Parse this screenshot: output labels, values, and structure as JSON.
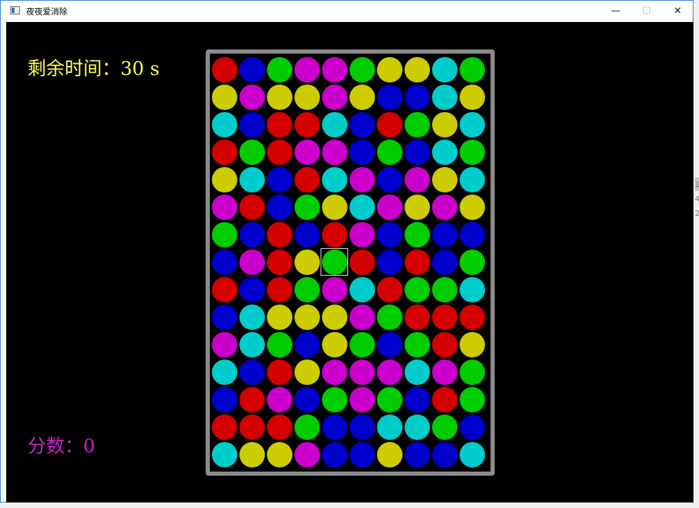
{
  "window": {
    "title": "夜夜爱消除"
  },
  "titlebar": {
    "minimize_glyph": "—",
    "maximize_glyph": "☐",
    "close_glyph": "✕"
  },
  "hud": {
    "timer_text": "剩余时间：30 s",
    "score_text": "分数：0"
  },
  "colors": {
    "R": "#d40000",
    "B": "#0000cc",
    "G": "#00cc00",
    "M": "#cc00cc",
    "Y": "#cccc00",
    "C": "#00cccc"
  },
  "board": {
    "rows": [
      [
        "R",
        "B",
        "G",
        "M",
        "M",
        "G",
        "Y",
        "Y",
        "C",
        "G"
      ],
      [
        "Y",
        "M",
        "Y",
        "Y",
        "M",
        "Y",
        "B",
        "B",
        "C",
        "Y"
      ],
      [
        "C",
        "B",
        "R",
        "R",
        "C",
        "B",
        "R",
        "G",
        "Y",
        "C"
      ],
      [
        "R",
        "G",
        "R",
        "M",
        "M",
        "B",
        "G",
        "B",
        "C",
        "G"
      ],
      [
        "Y",
        "C",
        "B",
        "R",
        "C",
        "M",
        "B",
        "M",
        "Y",
        "C"
      ],
      [
        "M",
        "R",
        "B",
        "G",
        "Y",
        "C",
        "M",
        "Y",
        "M",
        "Y"
      ],
      [
        "G",
        "B",
        "R",
        "B",
        "R",
        "M",
        "B",
        "G",
        "B",
        "B"
      ],
      [
        "B",
        "M",
        "R",
        "Y",
        "G",
        "R",
        "B",
        "R",
        "B",
        "G"
      ],
      [
        "R",
        "B",
        "R",
        "G",
        "M",
        "C",
        "R",
        "G",
        "G",
        "C"
      ],
      [
        "B",
        "C",
        "Y",
        "Y",
        "Y",
        "M",
        "G",
        "R",
        "R",
        "R"
      ],
      [
        "M",
        "C",
        "G",
        "B",
        "Y",
        "G",
        "B",
        "G",
        "R",
        "Y"
      ],
      [
        "C",
        "B",
        "R",
        "Y",
        "M",
        "M",
        "M",
        "C",
        "M",
        "G"
      ],
      [
        "B",
        "R",
        "M",
        "B",
        "G",
        "M",
        "G",
        "B",
        "R",
        "G"
      ],
      [
        "R",
        "R",
        "R",
        "G",
        "B",
        "B",
        "C",
        "C",
        "G",
        "B"
      ],
      [
        "C",
        "Y",
        "Y",
        "M",
        "B",
        "B",
        "Y",
        "B",
        "B",
        "C"
      ]
    ],
    "selected": {
      "row": 7,
      "col": 4
    }
  },
  "side": {
    "t1": "1",
    "t2": "4",
    "t3": "2"
  }
}
